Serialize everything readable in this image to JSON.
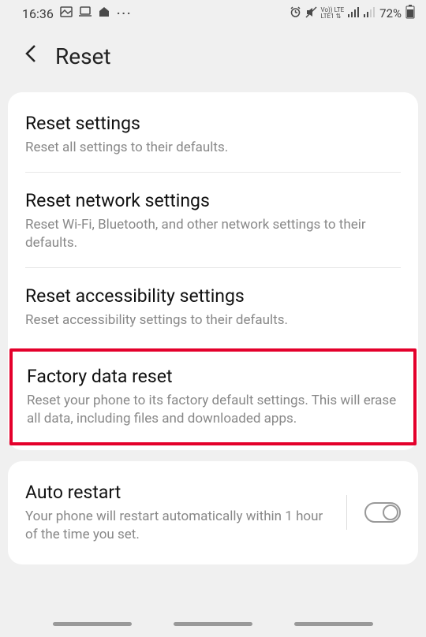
{
  "status": {
    "time": "16:36",
    "network_label": "Vo)) LTE\nLTE1",
    "battery": "72%"
  },
  "header": {
    "title": "Reset"
  },
  "resetItems": [
    {
      "title": "Reset settings",
      "desc": "Reset all settings to their defaults."
    },
    {
      "title": "Reset network settings",
      "desc": "Reset Wi-Fi, Bluetooth, and other network settings to their defaults."
    },
    {
      "title": "Reset accessibility settings",
      "desc": "Reset accessibility settings to their defaults."
    },
    {
      "title": "Factory data reset",
      "desc": "Reset your phone to its factory default settings. This will erase all data, including files and downloaded apps."
    }
  ],
  "autoRestart": {
    "title": "Auto restart",
    "desc": "Your phone will restart automatically within 1 hour of the time you set."
  }
}
